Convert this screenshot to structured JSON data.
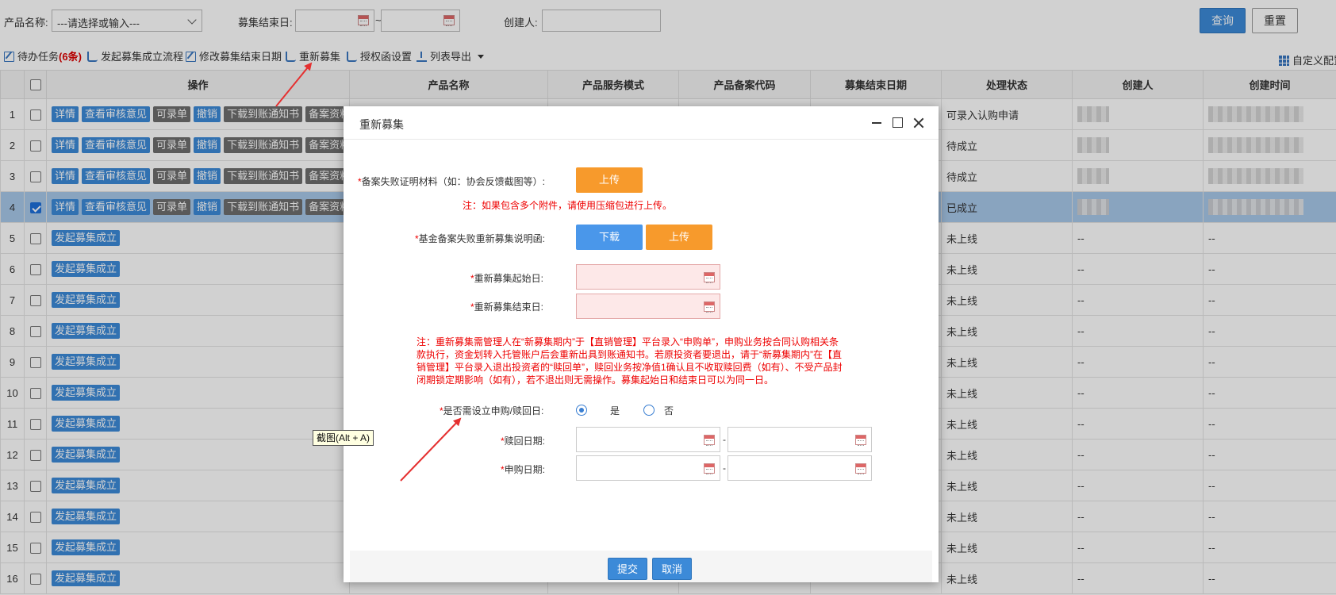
{
  "filters": {
    "product_name_label": "产品名称:",
    "product_name_value": "---请选择或输入---",
    "end_date_label": "募集结束日:",
    "date_separator": "~",
    "creator_label": "创建人:",
    "query_label": "查询",
    "reset_label": "重置"
  },
  "toolbar": {
    "todo_label": "待办任务",
    "todo_count": "(6条)",
    "start_flow": "发起募集成立流程",
    "modify_end_date": "修改募集结束日期",
    "re_raise": "重新募集",
    "auth_settings": "授权函设置",
    "export_list": "列表导出",
    "custom_config": "自定义配置"
  },
  "table": {
    "headers": [
      "操作",
      "产品名称",
      "产品服务模式",
      "产品备案代码",
      "募集结束日期",
      "处理状态",
      "创建人",
      "创建时间"
    ],
    "op_labels": {
      "detail": "详情",
      "view_review": "查看审核意见",
      "recordable": "可录单",
      "revoke": "撤销",
      "download_notice": "下载到账通知书",
      "filing_material": "备案资料下",
      "start_establish": "发起募集成立"
    },
    "rows": [
      {
        "num": "1",
        "status": "可录入认购申请",
        "creator": "",
        "created": "",
        "checked": false
      },
      {
        "num": "2",
        "status": "待成立",
        "creator": "",
        "created": "",
        "checked": false
      },
      {
        "num": "3",
        "status": "待成立",
        "creator": "",
        "created": "",
        "checked": false
      },
      {
        "num": "4",
        "status": "已成立",
        "creator": "",
        "created": "",
        "checked": true
      },
      {
        "num": "5",
        "status": "未上线",
        "creator": "--",
        "created": "--",
        "checked": false
      },
      {
        "num": "6",
        "status": "未上线",
        "creator": "--",
        "created": "--",
        "checked": false
      },
      {
        "num": "7",
        "status": "未上线",
        "creator": "--",
        "created": "--",
        "checked": false
      },
      {
        "num": "8",
        "status": "未上线",
        "creator": "--",
        "created": "--",
        "checked": false
      },
      {
        "num": "9",
        "status": "未上线",
        "creator": "--",
        "created": "--",
        "checked": false
      },
      {
        "num": "10",
        "status": "未上线",
        "creator": "--",
        "created": "--",
        "checked": false
      },
      {
        "num": "11",
        "status": "未上线",
        "creator": "--",
        "created": "--",
        "checked": false
      },
      {
        "num": "12",
        "status": "未上线",
        "creator": "--",
        "created": "--",
        "checked": false
      },
      {
        "num": "13",
        "status": "未上线",
        "creator": "--",
        "created": "--",
        "checked": false
      },
      {
        "num": "14",
        "status": "未上线",
        "creator": "--",
        "created": "--",
        "checked": false
      },
      {
        "num": "15",
        "status": "未上线",
        "creator": "--",
        "created": "--",
        "checked": false
      },
      {
        "num": "16",
        "status": "未上线",
        "creator": "--",
        "created": "--",
        "checked": false
      }
    ]
  },
  "dialog": {
    "title": "重新募集",
    "proof_label": "备案失败证明材料（如：协会反馈截图等）:",
    "upload_label": "上传",
    "attach_note": "注：如果包含多个附件，请使用压缩包进行上传。",
    "letter_label": "基金备案失败重新募集说明函:",
    "download_label": "下载",
    "start_date_label": "重新募集起始日:",
    "end_date_label": "重新募集结束日:",
    "notice_lines": [
      "注：重新募集需管理人在“新募集期内”于【直销管理】平台录入“申购单”，申购业务按合同认购相关条",
      "款执行，资金划转入托管账户后会重新出具到账通知书。若原投资者要退出，请于“新募集期内”在【直",
      "销管理】平台录入退出投资者的“赎回单”，赎回业务按净值1确认且不收取赎回费（如有）、不受产品封",
      "闭期锁定期影响（如有），若不退出则无需操作。募集起始日和结束日可以为同一日。"
    ],
    "need_date_label": "是否需设立申购/赎回日:",
    "yes_label": "是",
    "no_label": "否",
    "yes_selected": true,
    "redeem_date_label": "赎回日期:",
    "purchase_date_label": "申购日期:",
    "range_dash": "-",
    "submit_label": "提交",
    "cancel_label": "取消"
  },
  "tooltip": "截图(Alt + A)",
  "colors": {
    "primary": "#3c8ad8",
    "orange": "#f79a2c",
    "required": "#e00000",
    "selected_row": "#a8c8ea"
  }
}
